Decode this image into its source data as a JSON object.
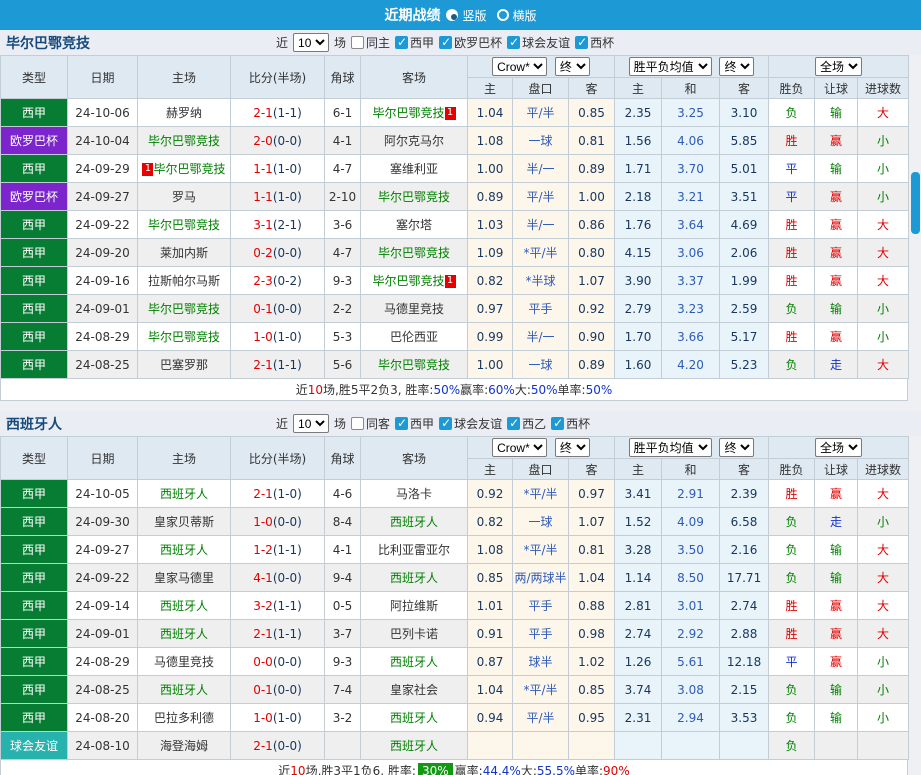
{
  "topbar": {
    "title": "近期战绩",
    "options": [
      {
        "label": "竖版",
        "selected": true
      },
      {
        "label": "横版",
        "selected": false
      }
    ]
  },
  "colors": {
    "topbar_bg": "#1d9ad6",
    "league_colors": {
      "西甲": "#077c33",
      "欧罗巴杯": "#7c25cc",
      "球会友谊": "#27b2ad"
    },
    "result_win": "#e00000",
    "result_draw": "#1133cc",
    "result_lose": "#008000",
    "odds_dark": "#17365d",
    "odds_blue": "#2f5bb7",
    "score_red": "#e00000",
    "team_green": "#008000",
    "summary_badge_green": "#119911"
  },
  "table_header": {
    "cols": [
      "类型",
      "日期",
      "主场",
      "比分(半场)",
      "角球",
      "客场"
    ],
    "sub": [
      "主",
      "盘口",
      "客",
      "主",
      "和",
      "客",
      "胜负",
      "让球",
      "进球数"
    ],
    "crow_label": "Crow*",
    "end1_label": "终",
    "avg_label": "胜平负均值",
    "end2_label": "终",
    "full_label": "全场"
  },
  "sections": [
    {
      "team": "毕尔巴鄂竞技",
      "filter": {
        "near_label": "近",
        "count": "10",
        "games_label": "场",
        "same": {
          "label": "同主",
          "checked": false
        },
        "leagues": [
          {
            "label": "西甲",
            "checked": true
          },
          {
            "label": "欧罗巴杯",
            "checked": true
          },
          {
            "label": "球会友谊",
            "checked": true
          },
          {
            "label": "西杯",
            "checked": true
          }
        ]
      },
      "rows": [
        {
          "league": "西甲",
          "date": "24-10-06",
          "home": {
            "name": "赫罗纳",
            "is_team": false,
            "badge": ""
          },
          "score": {
            "ft": "2-1",
            "ht": "(1-1)"
          },
          "corners": "6-1",
          "away": {
            "name": "毕尔巴鄂竞技",
            "is_team": true,
            "badge": "1"
          },
          "crow": [
            "1.04",
            "平/半",
            "0.85"
          ],
          "avg": [
            "2.35",
            "3.25",
            "3.10"
          ],
          "result": [
            "负",
            "输",
            "大"
          ]
        },
        {
          "league": "欧罗巴杯",
          "date": "24-10-04",
          "home": {
            "name": "毕尔巴鄂竞技",
            "is_team": true,
            "badge": ""
          },
          "score": {
            "ft": "2-0",
            "ht": "(0-0)"
          },
          "corners": "4-1",
          "away": {
            "name": "阿尔克马尔",
            "is_team": false,
            "badge": ""
          },
          "crow": [
            "1.08",
            "一球",
            "0.81"
          ],
          "avg": [
            "1.56",
            "4.06",
            "5.85"
          ],
          "result": [
            "胜",
            "赢",
            "小"
          ]
        },
        {
          "league": "西甲",
          "date": "24-09-29",
          "home": {
            "name": "毕尔巴鄂竞技",
            "is_team": true,
            "badge": "1"
          },
          "score": {
            "ft": "1-1",
            "ht": "(1-0)"
          },
          "corners": "4-7",
          "away": {
            "name": "塞维利亚",
            "is_team": false,
            "badge": ""
          },
          "crow": [
            "1.00",
            "半/一",
            "0.89"
          ],
          "avg": [
            "1.71",
            "3.70",
            "5.01"
          ],
          "result": [
            "平",
            "输",
            "小"
          ]
        },
        {
          "league": "欧罗巴杯",
          "date": "24-09-27",
          "home": {
            "name": "罗马",
            "is_team": false,
            "badge": ""
          },
          "score": {
            "ft": "1-1",
            "ht": "(1-0)"
          },
          "corners": "2-10",
          "away": {
            "name": "毕尔巴鄂竞技",
            "is_team": true,
            "badge": ""
          },
          "crow": [
            "0.89",
            "平/半",
            "1.00"
          ],
          "avg": [
            "2.18",
            "3.21",
            "3.51"
          ],
          "result": [
            "平",
            "赢",
            "小"
          ]
        },
        {
          "league": "西甲",
          "date": "24-09-22",
          "home": {
            "name": "毕尔巴鄂竞技",
            "is_team": true,
            "badge": ""
          },
          "score": {
            "ft": "3-1",
            "ht": "(2-1)"
          },
          "corners": "3-6",
          "away": {
            "name": "塞尔塔",
            "is_team": false,
            "badge": ""
          },
          "crow": [
            "1.03",
            "半/一",
            "0.86"
          ],
          "avg": [
            "1.76",
            "3.64",
            "4.69"
          ],
          "result": [
            "胜",
            "赢",
            "大"
          ]
        },
        {
          "league": "西甲",
          "date": "24-09-20",
          "home": {
            "name": "莱加内斯",
            "is_team": false,
            "badge": ""
          },
          "score": {
            "ft": "0-2",
            "ht": "(0-0)"
          },
          "corners": "4-7",
          "away": {
            "name": "毕尔巴鄂竞技",
            "is_team": true,
            "badge": ""
          },
          "crow": [
            "1.09",
            "*平/半",
            "0.80"
          ],
          "avg": [
            "4.15",
            "3.06",
            "2.06"
          ],
          "result": [
            "胜",
            "赢",
            "大"
          ]
        },
        {
          "league": "西甲",
          "date": "24-09-16",
          "home": {
            "name": "拉斯帕尔马斯",
            "is_team": false,
            "badge": ""
          },
          "score": {
            "ft": "2-3",
            "ht": "(0-2)"
          },
          "corners": "9-3",
          "away": {
            "name": "毕尔巴鄂竞技",
            "is_team": true,
            "badge": "1"
          },
          "crow": [
            "0.82",
            "*半球",
            "1.07"
          ],
          "avg": [
            "3.90",
            "3.37",
            "1.99"
          ],
          "result": [
            "胜",
            "赢",
            "大"
          ]
        },
        {
          "league": "西甲",
          "date": "24-09-01",
          "home": {
            "name": "毕尔巴鄂竞技",
            "is_team": true,
            "badge": ""
          },
          "score": {
            "ft": "0-1",
            "ht": "(0-0)"
          },
          "corners": "2-2",
          "away": {
            "name": "马德里竞技",
            "is_team": false,
            "badge": ""
          },
          "crow": [
            "0.97",
            "平手",
            "0.92"
          ],
          "avg": [
            "2.79",
            "3.23",
            "2.59"
          ],
          "result": [
            "负",
            "输",
            "小"
          ]
        },
        {
          "league": "西甲",
          "date": "24-08-29",
          "home": {
            "name": "毕尔巴鄂竞技",
            "is_team": true,
            "badge": ""
          },
          "score": {
            "ft": "1-0",
            "ht": "(1-0)"
          },
          "corners": "5-3",
          "away": {
            "name": "巴伦西亚",
            "is_team": false,
            "badge": ""
          },
          "crow": [
            "0.99",
            "半/一",
            "0.90"
          ],
          "avg": [
            "1.70",
            "3.66",
            "5.17"
          ],
          "result": [
            "胜",
            "赢",
            "小"
          ]
        },
        {
          "league": "西甲",
          "date": "24-08-25",
          "home": {
            "name": "巴塞罗那",
            "is_team": false,
            "badge": ""
          },
          "score": {
            "ft": "2-1",
            "ht": "(1-1)"
          },
          "corners": "5-6",
          "away": {
            "name": "毕尔巴鄂竞技",
            "is_team": true,
            "badge": ""
          },
          "crow": [
            "1.00",
            "一球",
            "0.89"
          ],
          "avg": [
            "1.60",
            "4.20",
            "5.23"
          ],
          "result": [
            "负",
            "走",
            "大"
          ]
        }
      ],
      "summary": [
        {
          "text": "近",
          "style": "plain"
        },
        {
          "text": "10",
          "style": "red"
        },
        {
          "text": "场,胜5平2负3, 胜率:",
          "style": "plain"
        },
        {
          "text": "50%",
          "style": "blue"
        },
        {
          "text": " 赢率:",
          "style": "plain"
        },
        {
          "text": "60%",
          "style": "blue"
        },
        {
          "text": " 大:",
          "style": "plain"
        },
        {
          "text": "50%",
          "style": "blue"
        },
        {
          "text": " 单率:",
          "style": "plain"
        },
        {
          "text": "50%",
          "style": "blue"
        }
      ]
    },
    {
      "team": "西班牙人",
      "filter": {
        "near_label": "近",
        "count": "10",
        "games_label": "场",
        "same": {
          "label": "同客",
          "checked": false
        },
        "leagues": [
          {
            "label": "西甲",
            "checked": true
          },
          {
            "label": "球会友谊",
            "checked": true
          },
          {
            "label": "西乙",
            "checked": true
          },
          {
            "label": "西杯",
            "checked": true
          }
        ]
      },
      "rows": [
        {
          "league": "西甲",
          "date": "24-10-05",
          "home": {
            "name": "西班牙人",
            "is_team": true,
            "badge": ""
          },
          "score": {
            "ft": "2-1",
            "ht": "(1-0)"
          },
          "corners": "4-6",
          "away": {
            "name": "马洛卡",
            "is_team": false,
            "badge": ""
          },
          "crow": [
            "0.92",
            "*平/半",
            "0.97"
          ],
          "avg": [
            "3.41",
            "2.91",
            "2.39"
          ],
          "result": [
            "胜",
            "赢",
            "大"
          ]
        },
        {
          "league": "西甲",
          "date": "24-09-30",
          "home": {
            "name": "皇家贝蒂斯",
            "is_team": false,
            "badge": ""
          },
          "score": {
            "ft": "1-0",
            "ht": "(0-0)"
          },
          "corners": "8-4",
          "away": {
            "name": "西班牙人",
            "is_team": true,
            "badge": ""
          },
          "crow": [
            "0.82",
            "一球",
            "1.07"
          ],
          "avg": [
            "1.52",
            "4.09",
            "6.58"
          ],
          "result": [
            "负",
            "走",
            "小"
          ]
        },
        {
          "league": "西甲",
          "date": "24-09-27",
          "home": {
            "name": "西班牙人",
            "is_team": true,
            "badge": ""
          },
          "score": {
            "ft": "1-2",
            "ht": "(1-1)"
          },
          "corners": "4-1",
          "away": {
            "name": "比利亚雷亚尔",
            "is_team": false,
            "badge": ""
          },
          "crow": [
            "1.08",
            "*平/半",
            "0.81"
          ],
          "avg": [
            "3.28",
            "3.50",
            "2.16"
          ],
          "result": [
            "负",
            "输",
            "大"
          ]
        },
        {
          "league": "西甲",
          "date": "24-09-22",
          "home": {
            "name": "皇家马德里",
            "is_team": false,
            "badge": ""
          },
          "score": {
            "ft": "4-1",
            "ht": "(0-0)"
          },
          "corners": "9-4",
          "away": {
            "name": "西班牙人",
            "is_team": true,
            "badge": ""
          },
          "crow": [
            "0.85",
            "两/两球半",
            "1.04"
          ],
          "avg": [
            "1.14",
            "8.50",
            "17.71"
          ],
          "result": [
            "负",
            "输",
            "大"
          ]
        },
        {
          "league": "西甲",
          "date": "24-09-14",
          "home": {
            "name": "西班牙人",
            "is_team": true,
            "badge": ""
          },
          "score": {
            "ft": "3-2",
            "ht": "(1-1)"
          },
          "corners": "0-5",
          "away": {
            "name": "阿拉维斯",
            "is_team": false,
            "badge": ""
          },
          "crow": [
            "1.01",
            "平手",
            "0.88"
          ],
          "avg": [
            "2.81",
            "3.01",
            "2.74"
          ],
          "result": [
            "胜",
            "赢",
            "大"
          ]
        },
        {
          "league": "西甲",
          "date": "24-09-01",
          "home": {
            "name": "西班牙人",
            "is_team": true,
            "badge": ""
          },
          "score": {
            "ft": "2-1",
            "ht": "(1-1)"
          },
          "corners": "3-7",
          "away": {
            "name": "巴列卡诺",
            "is_team": false,
            "badge": ""
          },
          "crow": [
            "0.91",
            "平手",
            "0.98"
          ],
          "avg": [
            "2.74",
            "2.92",
            "2.88"
          ],
          "result": [
            "胜",
            "赢",
            "大"
          ]
        },
        {
          "league": "西甲",
          "date": "24-08-29",
          "home": {
            "name": "马德里竞技",
            "is_team": false,
            "badge": ""
          },
          "score": {
            "ft": "0-0",
            "ht": "(0-0)"
          },
          "corners": "9-3",
          "away": {
            "name": "西班牙人",
            "is_team": true,
            "badge": ""
          },
          "crow": [
            "0.87",
            "球半",
            "1.02"
          ],
          "avg": [
            "1.26",
            "5.61",
            "12.18"
          ],
          "result": [
            "平",
            "赢",
            "小"
          ]
        },
        {
          "league": "西甲",
          "date": "24-08-25",
          "home": {
            "name": "西班牙人",
            "is_team": true,
            "badge": ""
          },
          "score": {
            "ft": "0-1",
            "ht": "(0-0)"
          },
          "corners": "7-4",
          "away": {
            "name": "皇家社会",
            "is_team": false,
            "badge": ""
          },
          "crow": [
            "1.04",
            "*平/半",
            "0.85"
          ],
          "avg": [
            "3.74",
            "3.08",
            "2.15"
          ],
          "result": [
            "负",
            "输",
            "小"
          ]
        },
        {
          "league": "西甲",
          "date": "24-08-20",
          "home": {
            "name": "巴拉多利德",
            "is_team": false,
            "badge": ""
          },
          "score": {
            "ft": "1-0",
            "ht": "(1-0)"
          },
          "corners": "3-2",
          "away": {
            "name": "西班牙人",
            "is_team": true,
            "badge": ""
          },
          "crow": [
            "0.94",
            "平/半",
            "0.95"
          ],
          "avg": [
            "2.31",
            "2.94",
            "3.53"
          ],
          "result": [
            "负",
            "输",
            "小"
          ]
        },
        {
          "league": "球会友谊",
          "date": "24-08-10",
          "home": {
            "name": "海登海姆",
            "is_team": false,
            "badge": ""
          },
          "score": {
            "ft": "2-1",
            "ht": "(0-0)"
          },
          "corners": "",
          "away": {
            "name": "西班牙人",
            "is_team": true,
            "badge": ""
          },
          "crow": [
            "",
            "",
            ""
          ],
          "avg": [
            "",
            "",
            ""
          ],
          "result": [
            "负",
            "",
            ""
          ]
        }
      ],
      "summary": [
        {
          "text": "近",
          "style": "plain"
        },
        {
          "text": "10",
          "style": "red"
        },
        {
          "text": "场,胜3平1负6, 胜率: ",
          "style": "plain"
        },
        {
          "text": "30%",
          "style": "badge"
        },
        {
          "text": " 赢率:",
          "style": "plain"
        },
        {
          "text": "44.4%",
          "style": "blue"
        },
        {
          "text": " 大:",
          "style": "plain"
        },
        {
          "text": "55.5%",
          "style": "blue"
        },
        {
          "text": " 单率:",
          "style": "plain"
        },
        {
          "text": "90%",
          "style": "red"
        }
      ]
    }
  ]
}
